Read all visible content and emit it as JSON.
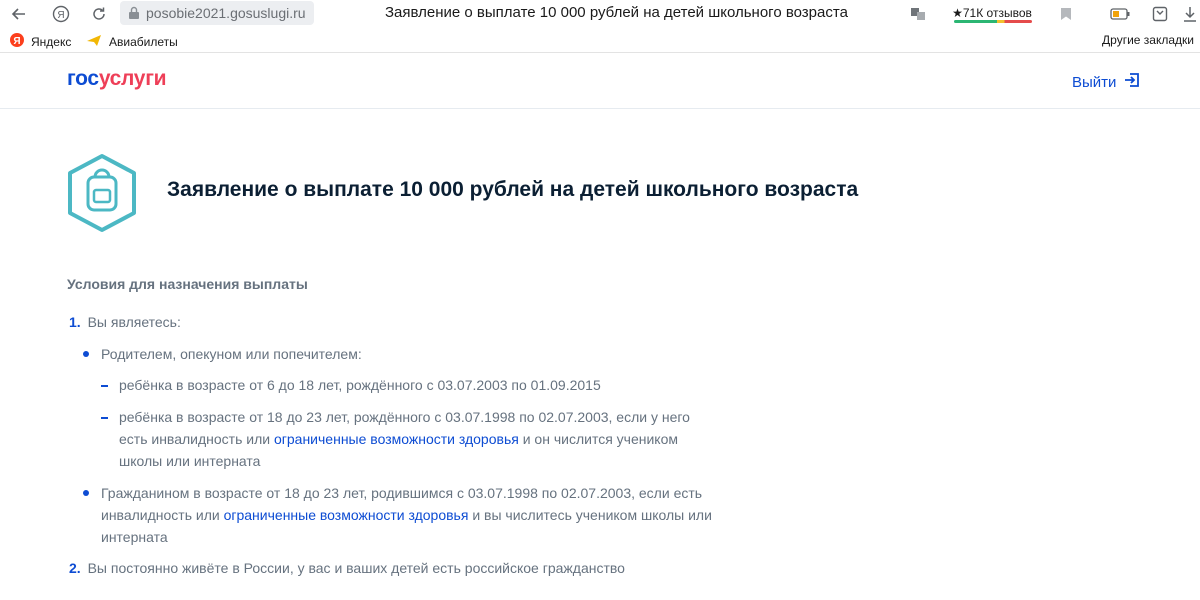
{
  "browser": {
    "url": "posobie2021.gosuslugi.ru",
    "tab_title": "Заявление о выплате 10 000 рублей на детей школьного возраста",
    "reviews_label": "★71К отзывов",
    "bookmarks": [
      {
        "label": "Яндекс",
        "icon": "yandex-icon"
      },
      {
        "label": "Авиабилеты",
        "icon": "plane-icon"
      }
    ],
    "other_bookmarks": "Другие закладки",
    "colors": {
      "chrome_bg": "#ffffff",
      "url_bg": "#eceef1"
    }
  },
  "header": {
    "logo_part1": "гос",
    "logo_part2": "услуги",
    "logout_label": "Выйти",
    "colors": {
      "brand_blue": "#0d4cd3",
      "brand_red": "#ee3f58"
    }
  },
  "main": {
    "icon": "backpack-icon",
    "title": "Заявление о выплате 10 000 рублей на детей школьного возраста",
    "section_title": "Условия для назначения выплаты",
    "item1": {
      "num": "1.",
      "text": "Вы являетесь:",
      "bullets": [
        {
          "text": "Родителем, опекуном или попечителем:",
          "subitems": [
            {
              "text": "ребёнка в возрасте от 6 до 18 лет, рождённого с 03.07.2003 по 01.09.2015"
            },
            {
              "text_before": "ребёнка в возрасте от 18 до 23 лет, рождённого с 03.07.1998 по 02.07.2003, если у него есть инвалидность или ",
              "link": "ограниченные возможности здоровья",
              "text_after": " и он числится учеником школы или интерната"
            }
          ]
        },
        {
          "text_before": "Гражданином в возрасте от 18 до 23 лет, родившимся с 03.07.1998 по 02.07.2003, если есть инвалидность или ",
          "link": "ограниченные возможности здоровья",
          "text_after": " и вы числитесь учеником школы или интерната"
        }
      ]
    },
    "item2": {
      "num": "2.",
      "text": "Вы постоянно живёте в России, у вас и ваших детей есть российское гражданство"
    },
    "colors": {
      "text_gray": "#66727f",
      "accent_blue": "#0d4cd3",
      "icon_teal": "#4cb8c4"
    }
  }
}
